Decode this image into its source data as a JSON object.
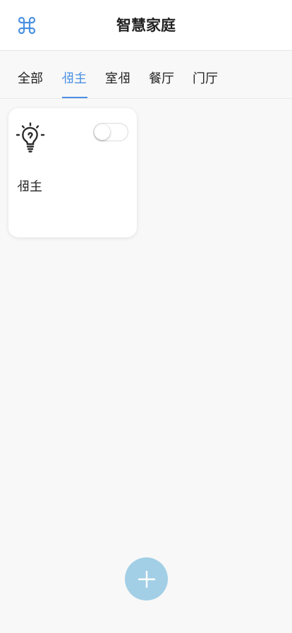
{
  "header": {
    "title": "智慧家庭",
    "menu_icon": "command-icon"
  },
  "tabs": [
    {
      "label": "全部",
      "active": false
    },
    {
      "label": "主卧",
      "active": true
    },
    {
      "label": "卧室",
      "active": false
    },
    {
      "label": "餐厅",
      "active": false
    },
    {
      "label": "门厅",
      "active": false
    }
  ],
  "devices": [
    {
      "icon": "lightbulb-icon",
      "name": "主卧",
      "switch_on": false
    }
  ],
  "fab": {
    "icon": "plus-icon"
  },
  "colors": {
    "accent": "#4a90e2",
    "fab": "#a2cfe6",
    "background": "#f8f8f8"
  }
}
